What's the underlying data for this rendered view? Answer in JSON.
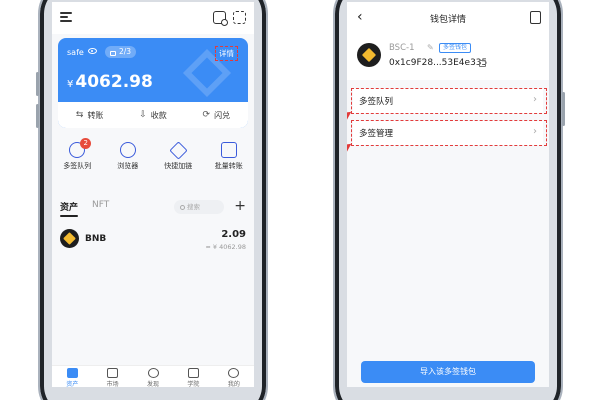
{
  "left_screen": {
    "card": {
      "wallet_name": "safe",
      "signatures": "2/3",
      "detail_label": "详情",
      "currency_symbol": "¥",
      "balance": "4062.98",
      "accent_color": "#3b8cf5",
      "actions": [
        {
          "icon": "transfer-icon",
          "label": "转账"
        },
        {
          "icon": "receive-icon",
          "label": "收款"
        },
        {
          "icon": "flash-swap-icon",
          "label": "闪兑"
        }
      ]
    },
    "quick_actions": [
      {
        "icon": "multisig-queue-icon",
        "label": "多签队列",
        "badge": "2"
      },
      {
        "icon": "browser-icon",
        "label": "浏览器"
      },
      {
        "icon": "quick-cross-chain-icon",
        "label": "快捷加链"
      },
      {
        "icon": "batch-transfer-icon",
        "label": "批量转账"
      }
    ],
    "asset_tabs": {
      "active": "资产",
      "inactive": "NFT",
      "search_placeholder": "搜索"
    },
    "assets": [
      {
        "symbol": "BNB",
        "amount": "2.09",
        "fiat": "≈ ¥ 4062.98"
      }
    ],
    "bottom_nav": [
      {
        "label": "资产",
        "active": true
      },
      {
        "label": "市场"
      },
      {
        "label": "发现"
      },
      {
        "label": "学院"
      },
      {
        "label": "我的"
      }
    ]
  },
  "right_screen": {
    "title": "钱包详情",
    "wallet": {
      "name": "BSC-1",
      "tag": "多签钱包",
      "address": "0x1c9F28...53E4e335"
    },
    "menu": [
      {
        "label": "多签队列"
      },
      {
        "label": "多签管理"
      }
    ],
    "import_button": "导入该多签钱包"
  }
}
